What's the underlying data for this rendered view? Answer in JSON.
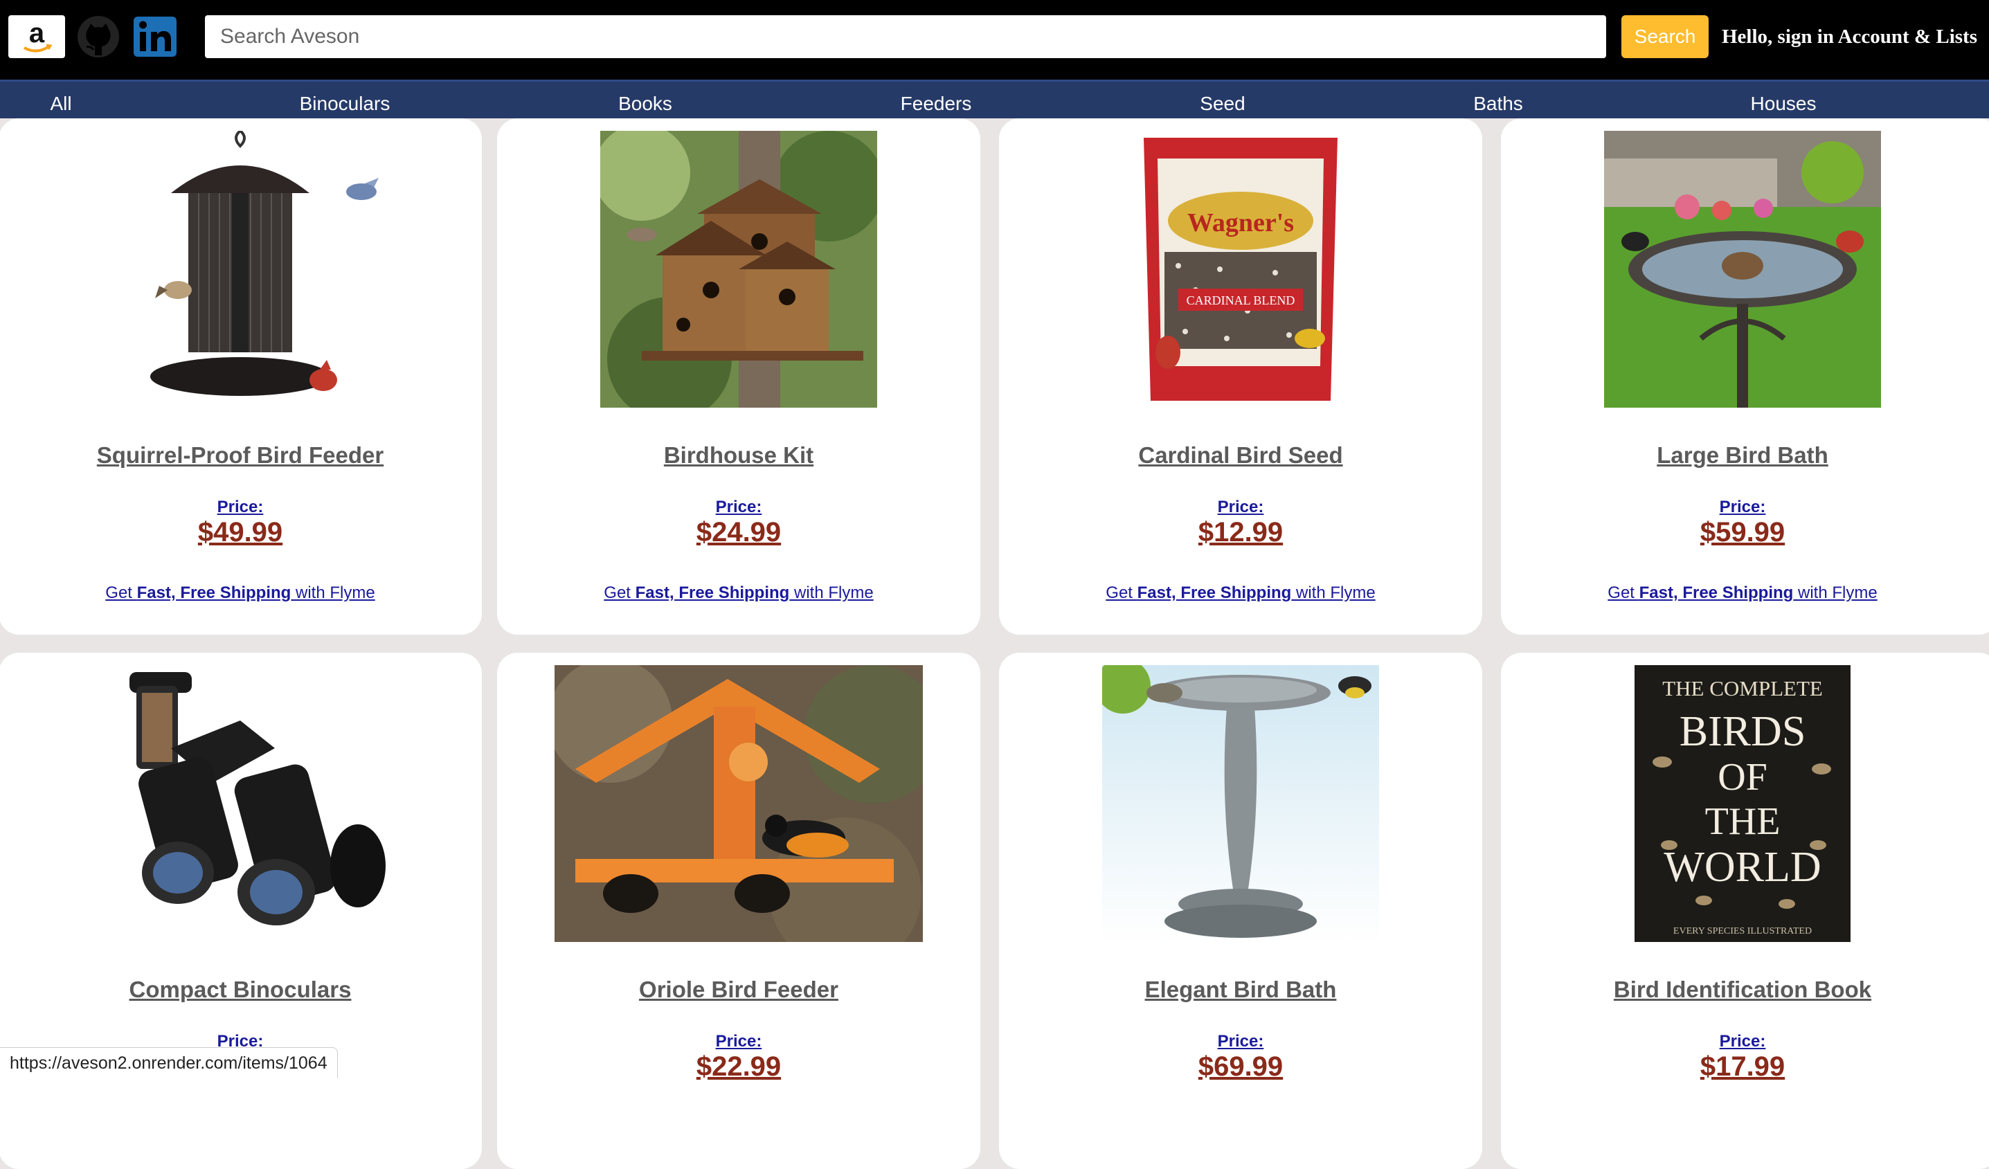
{
  "header": {
    "search_placeholder": "Search Aveson",
    "search_button": "Search",
    "account_text": "Hello, sign in Account & Lists"
  },
  "nav": {
    "items": [
      {
        "label": "All"
      },
      {
        "label": "Binoculars"
      },
      {
        "label": "Books"
      },
      {
        "label": "Feeders"
      },
      {
        "label": "Seed"
      },
      {
        "label": "Baths"
      },
      {
        "label": "Houses"
      }
    ]
  },
  "products": [
    {
      "title": "Squirrel-Proof Bird Feeder",
      "price_label": "Price:",
      "price": "$49.99",
      "shipping_prefix": "Get ",
      "shipping_bold": "Fast, Free Shipping",
      "shipping_suffix": " with Flyme"
    },
    {
      "title": "Birdhouse Kit",
      "price_label": "Price:",
      "price": "$24.99",
      "shipping_prefix": "Get ",
      "shipping_bold": "Fast, Free Shipping",
      "shipping_suffix": " with Flyme"
    },
    {
      "title": "Cardinal Bird Seed",
      "price_label": "Price:",
      "price": "$12.99",
      "shipping_prefix": "Get ",
      "shipping_bold": "Fast, Free Shipping",
      "shipping_suffix": " with Flyme",
      "package_text": "Wagner's",
      "package_subtext": "CARDINAL BLEND"
    },
    {
      "title": "Large Bird Bath",
      "price_label": "Price:",
      "price": "$59.99",
      "shipping_prefix": "Get ",
      "shipping_bold": "Fast, Free Shipping",
      "shipping_suffix": " with Flyme"
    },
    {
      "title": "Compact Binoculars",
      "price_label": "Price:",
      "price": ""
    },
    {
      "title": "Oriole Bird Feeder",
      "price_label": "Price:",
      "price": "$22.99"
    },
    {
      "title": "Elegant Bird Bath",
      "price_label": "Price:",
      "price": "$69.99"
    },
    {
      "title": "Bird Identification Book",
      "price_label": "Price:",
      "price": "$17.99",
      "book_line1": "THE COMPLETE",
      "book_line2": "BIRDS",
      "book_line3": "OF",
      "book_line4": "THE",
      "book_line5": "WORLD",
      "book_footer": "EVERY SPECIES ILLUSTRATED"
    }
  ],
  "status_bar": {
    "url": "https://aveson2.onrender.com/items/1064"
  },
  "colors": {
    "header_bg": "#000000",
    "nav_bg": "#263a68",
    "search_button": "#febd2f",
    "price": "#8a2a1a",
    "link": "#1a1a9c"
  },
  "icons": [
    "amazon-logo-icon",
    "github-icon",
    "linkedin-icon"
  ]
}
